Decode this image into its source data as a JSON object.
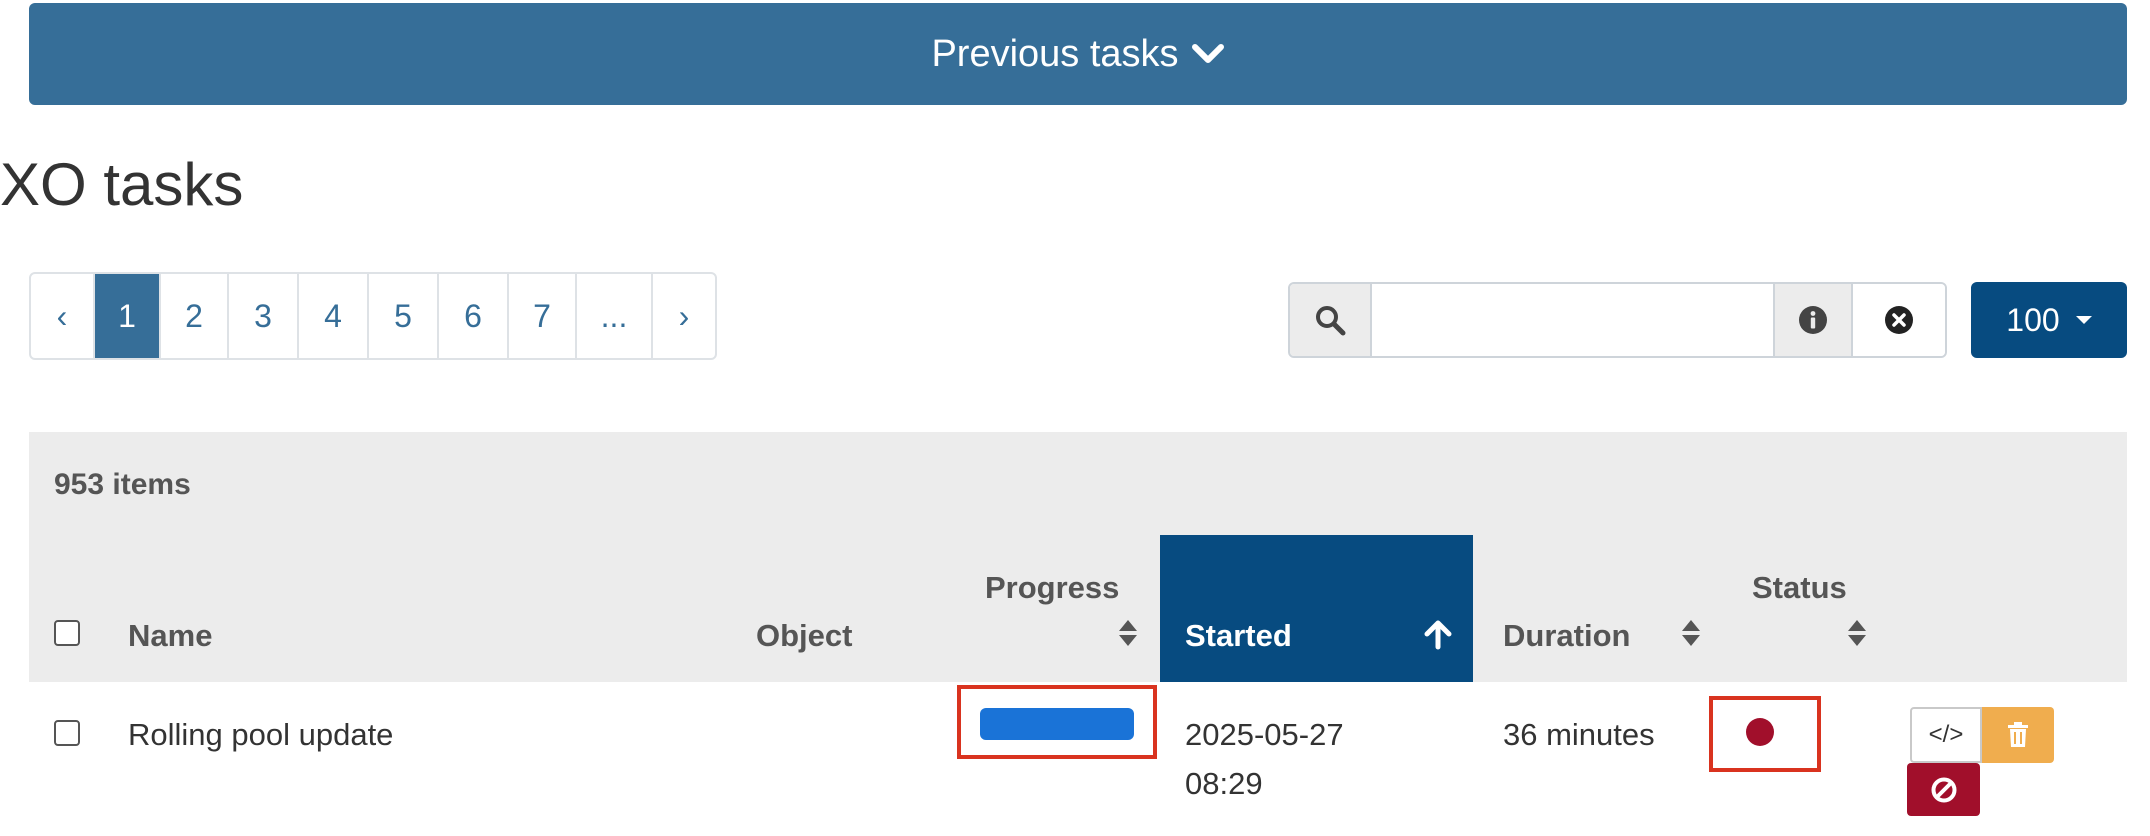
{
  "top_bar": {
    "label": "Previous tasks"
  },
  "page_title": "XO tasks",
  "pagination": {
    "prev": "‹",
    "pages": [
      "1",
      "2",
      "3",
      "4",
      "5",
      "6",
      "7",
      "..."
    ],
    "next": "›",
    "active": "1"
  },
  "search": {
    "value": "",
    "placeholder": ""
  },
  "page_size": {
    "value": "100"
  },
  "table": {
    "items_count": "953 items",
    "columns": {
      "name": "Name",
      "object": "Object",
      "progress": "Progress",
      "started": "Started",
      "duration": "Duration",
      "status": "Status"
    },
    "rows": [
      {
        "name": "Rolling pool update",
        "object": "",
        "progress_fraction": 1.0,
        "started_date": "2025-05-27",
        "started_time": "08:29",
        "duration": "36 minutes",
        "status": "failure"
      }
    ]
  },
  "colors": {
    "primary": "#366e98",
    "dark_primary": "#074b80",
    "progress": "#1a73d7",
    "danger": "#a10f2b",
    "warning": "#f0ad4e",
    "highlight_frame": "#d9331f"
  },
  "icons": {
    "toggle": "chevron-down-icon",
    "search": "search-icon",
    "info": "info-icon",
    "clear": "clear-icon",
    "sort": "sort-icon",
    "sort_asc": "arrow-up-icon",
    "code": "code-icon",
    "delete": "trash-icon",
    "cancel": "ban-icon"
  }
}
